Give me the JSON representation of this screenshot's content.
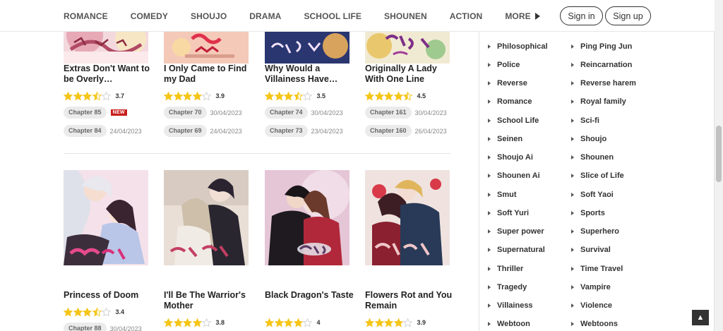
{
  "nav": {
    "items": [
      "ROMANCE",
      "COMEDY",
      "SHOUJO",
      "DRAMA",
      "SCHOOL LIFE",
      "SHOUNEN",
      "ACTION"
    ],
    "more_label": "MORE",
    "signin_label": "Sign in",
    "signup_label": "Sign up"
  },
  "row1": [
    {
      "title": "Extras Don't Want to be Overly…",
      "rating": "3.7",
      "rating_value": 3.5,
      "ch1": "Chapter 85",
      "d1": "NEW",
      "new": true,
      "ch2": "Chapter 84",
      "d2": "24/04/2023"
    },
    {
      "title": "I Only Came to Find my Dad",
      "rating": "3.9",
      "rating_value": 4,
      "ch1": "Chapter 70",
      "d1": "30/04/2023",
      "ch2": "Chapter 69",
      "d2": "24/04/2023"
    },
    {
      "title": "Why Would a Villainess Have…",
      "rating": "3.5",
      "rating_value": 3.5,
      "ch1": "Chapter 74",
      "d1": "30/04/2023",
      "ch2": "Chapter 73",
      "d2": "23/04/2023"
    },
    {
      "title": "Originally A Lady With One Line",
      "rating": "4.5",
      "rating_value": 4.5,
      "ch1": "Chapter 161",
      "d1": "30/04/2023",
      "ch2": "Chapter 160",
      "d2": "26/04/2023"
    }
  ],
  "row2": [
    {
      "title": "Princess of Doom",
      "rating": "3.4",
      "rating_value": 3.5,
      "ch1": "Chapter 88",
      "d1": "30/04/2023"
    },
    {
      "title": "I'll Be The Warrior's Mother",
      "rating": "3.8",
      "rating_value": 4,
      "ch1": "",
      "d1": ""
    },
    {
      "title": "Black Dragon's Taste",
      "rating": "4",
      "rating_value": 4,
      "ch1": "",
      "d1": ""
    },
    {
      "title": "Flowers Rot and You Remain",
      "rating": "3.9",
      "rating_value": 4,
      "ch1": "",
      "d1": ""
    }
  ],
  "genres_left": [
    "Philosophical",
    "Police",
    "Reverse",
    "Romance",
    "School Life",
    "Seinen",
    "Shoujo Ai",
    "Shounen Ai",
    "Smut",
    "Soft Yuri",
    "Super power",
    "Supernatural",
    "Thriller",
    "Tragedy",
    "Villainess",
    "Webtoon"
  ],
  "genres_right": [
    "Ping Ping Jun",
    "Reincarnation",
    "Reverse harem",
    "Royal family",
    "Sci-fi",
    "Shoujo",
    "Shounen",
    "Slice of Life",
    "Soft Yaoi",
    "Sports",
    "Superhero",
    "Survival",
    "Time Travel",
    "Vampire",
    "Violence",
    "Webtoons"
  ],
  "colors": {
    "star": "#f5c518",
    "star_empty": "#cfcfcf",
    "new_badge": "#c81e1e",
    "chip_bg": "#ebebeb"
  },
  "icons": {
    "back_to_top": "arrow-up-icon",
    "more": "triangle-right-icon",
    "genre_bullet": "triangle-right-icon"
  }
}
